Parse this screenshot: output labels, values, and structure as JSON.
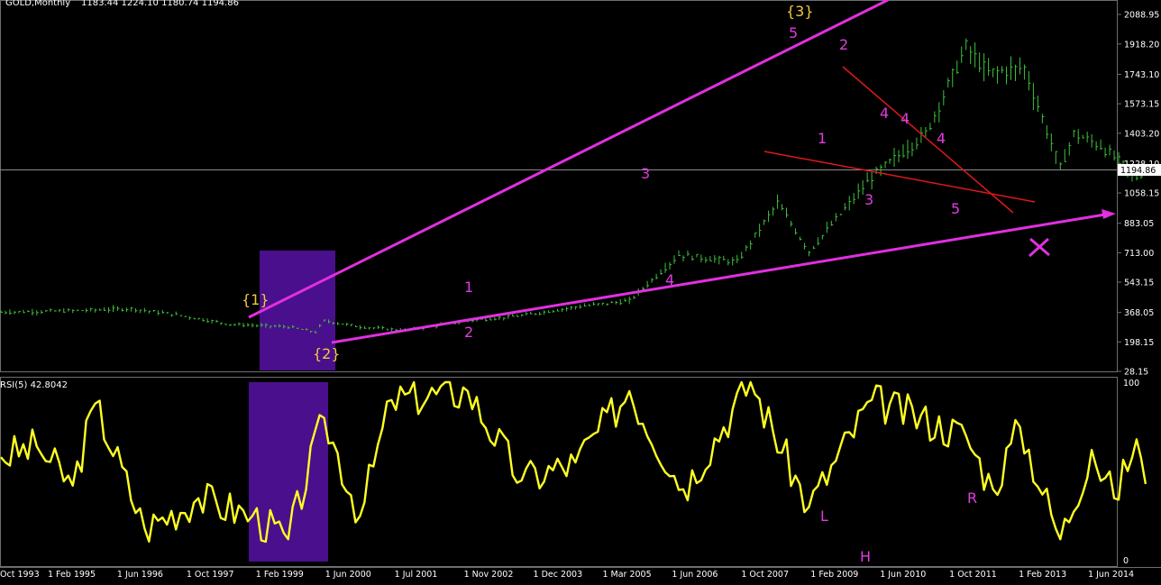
{
  "header": {
    "symbol": "GOLD,Monthly",
    "ohlc": "1183.44 1224.10 1180.74 1194.86"
  },
  "colors": {
    "background": "#000000",
    "candles": "#3cc23c",
    "rsi_line": "#ffff22",
    "wave_labels": "#e03ce0",
    "major_wave_labels": "#f2c840",
    "channel_lines": "#e030e0",
    "triangle_lines": "#e01818",
    "highlight_box": "#4a0f8c",
    "grid": "#6e6e6e"
  },
  "rsi_panel": {
    "label": "RSI(5) 42.8042",
    "top_tick": "100",
    "bottom_tick": "0",
    "pattern_labels": [
      "L",
      "H",
      "R"
    ]
  },
  "chart_data": {
    "type": "candlestick",
    "title": "GOLD,Monthly",
    "price_axis_ticks": [
      "2088.95",
      "1918.20",
      "1743.10",
      "1573.15",
      "1403.20",
      "1228.10",
      "1058.15",
      "883.05",
      "713.00",
      "543.15",
      "368.05",
      "198.15",
      "28.15"
    ],
    "last_price": "1194.86",
    "x_tick_labels": [
      "Oct 1993",
      "1 Feb 1995",
      "1 Jun 1996",
      "1 Oct 1997",
      "1 Feb 1999",
      "1 Jun 2000",
      "1 Jul 2001",
      "1 Nov 2002",
      "1 Dec 2003",
      "1 Mar 2005",
      "1 Jun 2006",
      "1 Oct 2007",
      "1 Feb 2009",
      "1 Jun 2010",
      "1 Oct 2011",
      "1 Feb 2013",
      "1 Jun 2014"
    ],
    "price_series": [
      {
        "date": "1993-10",
        "close": 370
      },
      {
        "date": "1995-02",
        "close": 378
      },
      {
        "date": "1996-03",
        "close": 390
      },
      {
        "date": "1997-01",
        "close": 355
      },
      {
        "date": "1998-01",
        "close": 300
      },
      {
        "date": "1999-02",
        "close": 285
      },
      {
        "date": "1999-08",
        "close": 255
      },
      {
        "date": "1999-10",
        "close": 320
      },
      {
        "date": "2000-06",
        "close": 285
      },
      {
        "date": "2001-04",
        "close": 265
      },
      {
        "date": "2002-06",
        "close": 320
      },
      {
        "date": "2003-06",
        "close": 350
      },
      {
        "date": "2004-06",
        "close": 400
      },
      {
        "date": "2005-06",
        "close": 435
      },
      {
        "date": "2006-05",
        "close": 700
      },
      {
        "date": "2007-06",
        "close": 660
      },
      {
        "date": "2008-03",
        "close": 1000
      },
      {
        "date": "2008-10",
        "close": 720
      },
      {
        "date": "2009-12",
        "close": 1150
      },
      {
        "date": "2010-12",
        "close": 1400
      },
      {
        "date": "2011-09",
        "close": 1900
      },
      {
        "date": "2012-02",
        "close": 1750
      },
      {
        "date": "2012-10",
        "close": 1780
      },
      {
        "date": "2013-06",
        "close": 1200
      },
      {
        "date": "2013-09",
        "close": 1400
      },
      {
        "date": "2014-03",
        "close": 1330
      },
      {
        "date": "2014-11",
        "close": 1150
      },
      {
        "date": "2015-01",
        "close": 1195
      }
    ],
    "rsi_series": [
      {
        "date": "1993-10",
        "value": 58
      },
      {
        "date": "1994-06",
        "value": 64
      },
      {
        "date": "1995-02",
        "value": 42
      },
      {
        "date": "1995-07",
        "value": 88
      },
      {
        "date": "1996-06",
        "value": 18
      },
      {
        "date": "1997-06",
        "value": 35
      },
      {
        "date": "1998-06",
        "value": 25
      },
      {
        "date": "1999-02",
        "value": 12
      },
      {
        "date": "1999-10",
        "value": 80
      },
      {
        "date": "2000-06",
        "value": 25
      },
      {
        "date": "2001-01",
        "value": 90
      },
      {
        "date": "2002-06",
        "value": 95
      },
      {
        "date": "2003-06",
        "value": 45
      },
      {
        "date": "2004-06",
        "value": 55
      },
      {
        "date": "2005-06",
        "value": 95
      },
      {
        "date": "2006-06",
        "value": 40
      },
      {
        "date": "2007-09",
        "value": 100
      },
      {
        "date": "2008-10",
        "value": 30
      },
      {
        "date": "2009-12",
        "value": 90
      },
      {
        "date": "2011-09",
        "value": 70
      },
      {
        "date": "2012-03",
        "value": 40
      },
      {
        "date": "2012-09",
        "value": 75
      },
      {
        "date": "2013-06",
        "value": 12
      },
      {
        "date": "2014-01",
        "value": 62
      },
      {
        "date": "2014-06",
        "value": 35
      },
      {
        "date": "2014-11",
        "value": 68
      },
      {
        "date": "2015-01",
        "value": 43
      }
    ],
    "wave_labels": [
      "{1}",
      "{2}",
      "{3}",
      "1",
      "2",
      "3",
      "4",
      "5",
      "2",
      "1",
      "4",
      "4",
      "4",
      "3",
      "5"
    ],
    "grid": false,
    "legend": "none"
  }
}
